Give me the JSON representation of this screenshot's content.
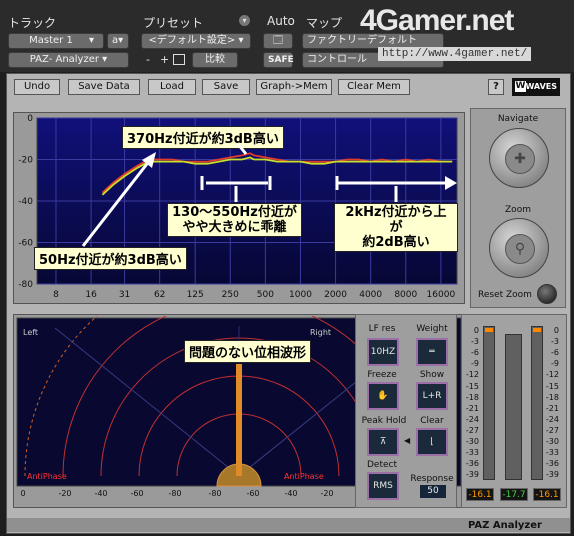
{
  "header": {
    "track_label": "トラック",
    "preset_label": "プリセット",
    "auto_label": "Auto",
    "map_label": "マップ",
    "track_value": "Master 1",
    "track_suffix": "a",
    "plugin_value": "PAZ- Analyzer",
    "preset_value": "<デフォルト設定>",
    "minus": "-",
    "plus": "+",
    "compare": "比較",
    "safe": "SAFE",
    "map_factory": "ファクトリーデフォルト",
    "map_control": "コントロール",
    "watermark_logo": "4Gamer.net",
    "watermark_url": "http://www.4gamer.net/"
  },
  "toolbar": {
    "undo": "Undo",
    "save_data": "Save Data",
    "load": "Load",
    "save": "Save",
    "graph_mem": "Graph->Mem",
    "clear_mem": "Clear Mem",
    "help": "?",
    "waves_logo": "WAVES"
  },
  "navigate": {
    "navigate_label": "Navigate",
    "zoom_label": "Zoom",
    "reset_zoom_label": "Reset Zoom"
  },
  "chart_data": {
    "type": "line",
    "x_scale": "log",
    "x_ticks": [
      "8",
      "16",
      "31",
      "62",
      "125",
      "250",
      "500",
      "1000",
      "2000",
      "4000",
      "8000",
      "16000"
    ],
    "y_ticks": [
      "0",
      "-20",
      "-40",
      "-60",
      "-80"
    ],
    "ylim": [
      -80,
      0
    ],
    "grid": true,
    "x": [
      20,
      25,
      31,
      40,
      50,
      62,
      80,
      100,
      125,
      160,
      200,
      250,
      315,
      370,
      400,
      500,
      630,
      800,
      1000,
      1250,
      1600,
      2000,
      2500,
      3150,
      4000,
      5000,
      6300,
      8000,
      10000,
      12500,
      16000,
      20000
    ],
    "series": [
      {
        "color": "#e23b2b",
        "values": [
          -36,
          -31,
          -27,
          -23,
          -20,
          -20,
          -20,
          -21,
          -21,
          -21,
          -20,
          -19,
          -18,
          -17,
          -18,
          -19,
          -20,
          -21,
          -21,
          -21,
          -21,
          -21,
          -20,
          -20,
          -21,
          -20,
          -21,
          -20,
          -21,
          -20,
          -21,
          -21
        ]
      },
      {
        "color": "#c8e02a",
        "values": [
          -37,
          -32,
          -28,
          -24,
          -21,
          -21,
          -21,
          -21,
          -22,
          -22,
          -21,
          -20,
          -20,
          -19,
          -20,
          -20,
          -21,
          -21,
          -21,
          -22,
          -22,
          -21,
          -21,
          -21,
          -21,
          -21,
          -21,
          -21,
          -21,
          -21,
          -21,
          -21
        ]
      }
    ],
    "annotations": [
      "370Hz付近が約3dB高い",
      "130〜550Hz付近が",
      "やや大きめに乖離",
      "50Hz付近が約3dB高い",
      "2kHz付近から上が",
      "約2dB高い"
    ]
  },
  "phase": {
    "left_label": "Left",
    "right_label": "Right",
    "antiphase_left": "AntiPhase",
    "antiphase_right": "AntiPhase",
    "x_ticks": [
      "0",
      "-20",
      "-40",
      "-60",
      "-80",
      "-80",
      "-60",
      "-40",
      "-20",
      "0"
    ],
    "annotation": "問題のない位相波形"
  },
  "controls": {
    "lf_res": "LF res",
    "lf_res_value": "10HZ",
    "weight": "Weight",
    "freeze": "Freeze",
    "show": "Show",
    "show_value": "L+R",
    "peak_hold": "Peak Hold",
    "clear": "Clear",
    "detect": "Detect",
    "detect_value": "RMS",
    "response": "Response",
    "response_value": "50"
  },
  "meters": {
    "scale": [
      "0",
      "-3",
      "-6",
      "-9",
      "-12",
      "-15",
      "-18",
      "-21",
      "-24",
      "-27",
      "-30",
      "-33",
      "-36",
      "-39"
    ],
    "readouts": [
      "-16.1",
      "-17.7",
      "-16.1"
    ],
    "readout_colors": [
      "#ff9900",
      "#44cc44",
      "#ff9900"
    ]
  },
  "footer": {
    "product_name": "PAZ Analyzer"
  }
}
